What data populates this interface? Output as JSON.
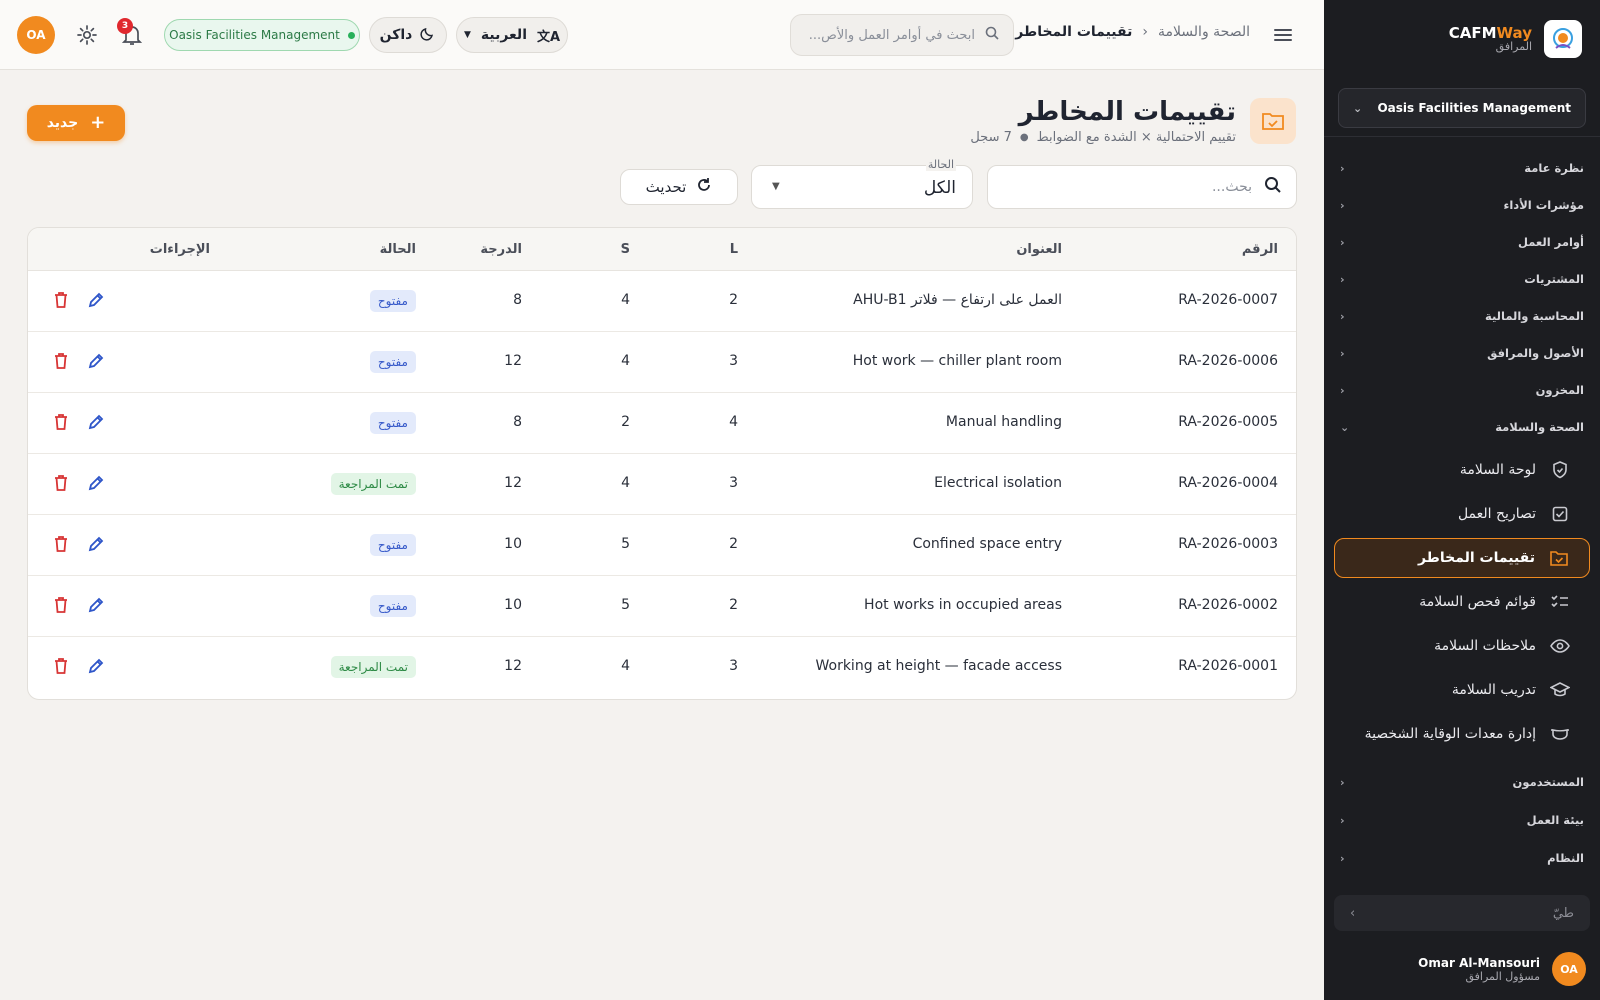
{
  "brand": {
    "name_prefix": "CAFM",
    "name_suffix": "Way",
    "subtitle": "المرافق"
  },
  "sidebar": {
    "org": "Oasis Facilities Management",
    "sections": [
      {
        "label": "نظرة عامة"
      },
      {
        "label": "مؤشرات الأداء"
      },
      {
        "label": "أوامر العمل"
      },
      {
        "label": "المشتريات"
      },
      {
        "label": "المحاسبة والمالية"
      },
      {
        "label": "الأصول والمرافق"
      },
      {
        "label": "المخزون"
      },
      {
        "label": "الصحة والسلامة"
      }
    ],
    "items": [
      {
        "label": "لوحة السلامة",
        "icon": "shield-icon"
      },
      {
        "label": "تصاريح العمل",
        "icon": "checkbox-icon"
      },
      {
        "label": "تقييمات المخاطر",
        "icon": "folder-check-icon"
      },
      {
        "label": "قوائم فحص السلامة",
        "icon": "checklist-icon"
      },
      {
        "label": "ملاحظات السلامة",
        "icon": "eye-icon"
      },
      {
        "label": "تدريب السلامة",
        "icon": "graduation-cap-icon"
      },
      {
        "label": "إدارة معدات الوقاية الشخصية",
        "icon": "mask-icon"
      }
    ],
    "sections_after": [
      {
        "label": "المستخدمون"
      },
      {
        "label": "بيئة العمل"
      },
      {
        "label": "النظام"
      }
    ],
    "collapse_label": "طيّ",
    "user": {
      "initials": "OA",
      "name": "Omar Al-Mansouri",
      "role": "مسؤول المرافق"
    }
  },
  "topbar": {
    "breadcrumb_parent": "الصحة والسلامة",
    "breadcrumb_current": "تقييمات المخاطر",
    "search_placeholder": "ابحث في أوامر العمل والأص...",
    "language": "العربية",
    "theme": "داكن",
    "org_badge": "Oasis Facilities Management",
    "notifications": "3",
    "avatar": "OA"
  },
  "page": {
    "title": "تقييمات المخاطر",
    "subtitle": "تقييم الاحتمالية × الشدة مع الضوابط",
    "record_count": "7 سجل",
    "new_button": "جديد"
  },
  "filters": {
    "search_placeholder": "بحث...",
    "status_label": "الحالة",
    "status_value": "الكل",
    "refresh_label": "تحديث"
  },
  "table": {
    "headers": {
      "id": "الرقم",
      "title": "العنوان",
      "l": "L",
      "s": "S",
      "score": "الدرجة",
      "status": "الحالة",
      "actions": "الإجراءات"
    },
    "rows": [
      {
        "id": "RA-2026-0007",
        "title": "العمل على ارتفاع — فلاتر AHU-B1",
        "l": "2",
        "s": "4",
        "score": "8",
        "status": "مفتوح",
        "status_kind": "open"
      },
      {
        "id": "RA-2026-0006",
        "title": "Hot work — chiller plant room",
        "l": "3",
        "s": "4",
        "score": "12",
        "status": "مفتوح",
        "status_kind": "open"
      },
      {
        "id": "RA-2026-0005",
        "title": "Manual handling",
        "l": "4",
        "s": "2",
        "score": "8",
        "status": "مفتوح",
        "status_kind": "open"
      },
      {
        "id": "RA-2026-0004",
        "title": "Electrical isolation",
        "l": "3",
        "s": "4",
        "score": "12",
        "status": "تمت المراجعة",
        "status_kind": "reviewed"
      },
      {
        "id": "RA-2026-0003",
        "title": "Confined space entry",
        "l": "2",
        "s": "5",
        "score": "10",
        "status": "مفتوح",
        "status_kind": "open"
      },
      {
        "id": "RA-2026-0002",
        "title": "Hot works in occupied areas",
        "l": "2",
        "s": "5",
        "score": "10",
        "status": "مفتوح",
        "status_kind": "open"
      },
      {
        "id": "RA-2026-0001",
        "title": "Working at height — facade access",
        "l": "3",
        "s": "4",
        "score": "12",
        "status": "تمت المراجعة",
        "status_kind": "reviewed"
      }
    ]
  },
  "colors": {
    "accent": "#f18a1f",
    "sidebar_bg": "#1c1d21",
    "open_pill": "#3659c9",
    "reviewed_pill": "#2d8a45",
    "delete": "#d83535",
    "edit": "#2f56c9"
  }
}
